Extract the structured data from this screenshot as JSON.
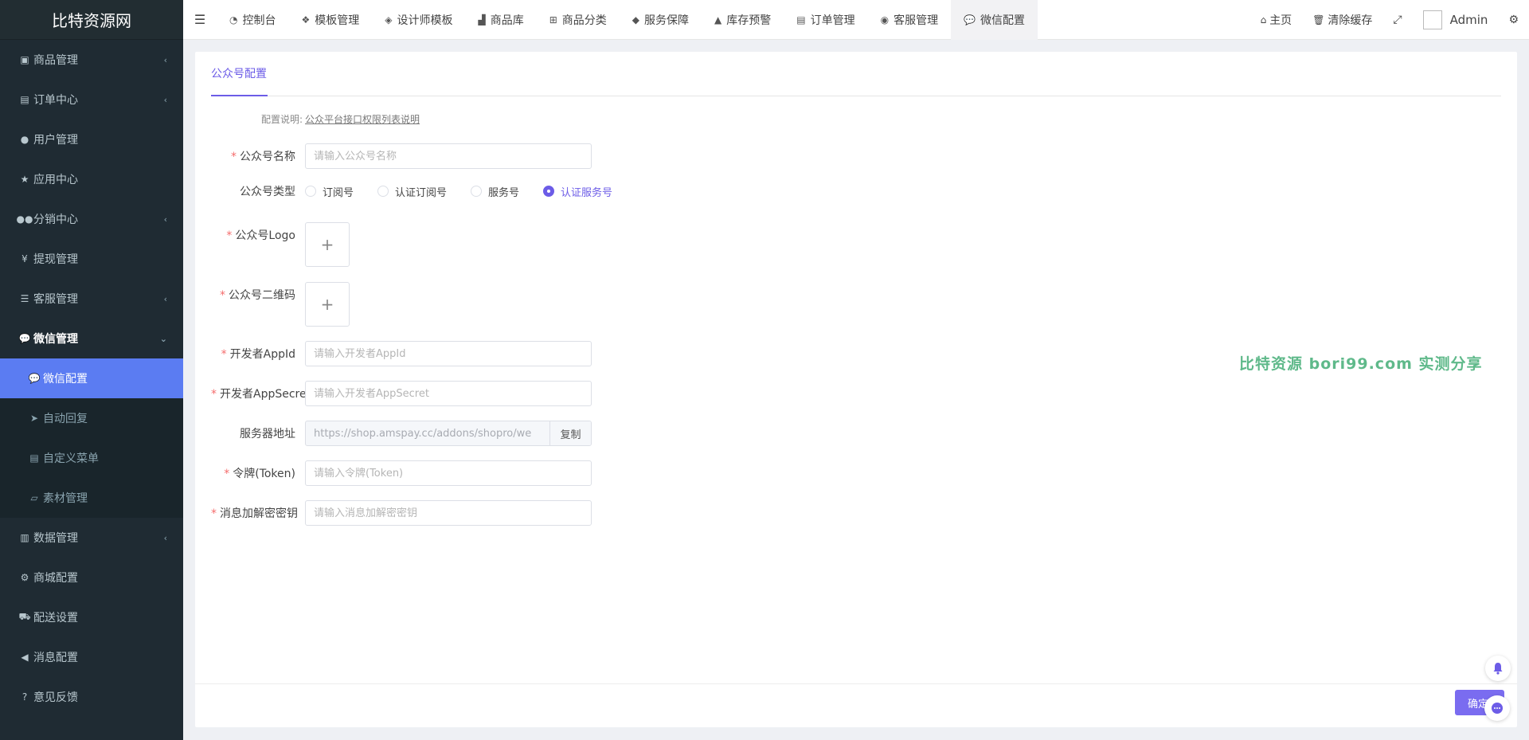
{
  "app": {
    "logo_text": "比特资源网"
  },
  "sidebar": {
    "items": [
      {
        "label": "商品管理",
        "icon": "archive-icon",
        "chevron": "‹"
      },
      {
        "label": "订单中心",
        "icon": "file-icon",
        "chevron": "‹"
      },
      {
        "label": "用户管理",
        "icon": "user-icon",
        "chevron": ""
      },
      {
        "label": "应用中心",
        "icon": "star-icon",
        "chevron": ""
      },
      {
        "label": "分销中心",
        "icon": "users-icon",
        "chevron": "‹"
      },
      {
        "label": "提现管理",
        "icon": "yen-icon",
        "chevron": ""
      },
      {
        "label": "客服管理",
        "icon": "list-icon",
        "chevron": "‹"
      },
      {
        "label": "微信管理",
        "icon": "wechat-icon",
        "chevron": "⌄"
      }
    ],
    "wechat_sub": [
      {
        "label": "微信配置",
        "icon": "comments-icon"
      },
      {
        "label": "自动回复",
        "icon": "paper-plane-icon"
      },
      {
        "label": "自定义菜单",
        "icon": "list-alt-icon"
      },
      {
        "label": "素材管理",
        "icon": "folder-open-icon"
      }
    ],
    "items_after": [
      {
        "label": "数据管理",
        "icon": "bar-chart-icon",
        "chevron": "‹"
      },
      {
        "label": "商城配置",
        "icon": "cogs-icon",
        "chevron": ""
      },
      {
        "label": "配送设置",
        "icon": "car-icon",
        "chevron": ""
      },
      {
        "label": "消息配置",
        "icon": "bullhorn-icon",
        "chevron": ""
      },
      {
        "label": "意见反馈",
        "icon": "question-icon",
        "chevron": ""
      }
    ]
  },
  "topbar": {
    "tabs": [
      {
        "label": "控制台",
        "icon": "dashboard-icon"
      },
      {
        "label": "模板管理",
        "icon": "cubes-icon"
      },
      {
        "label": "设计师模板",
        "icon": "cube-icon"
      },
      {
        "label": "商品库",
        "icon": "shopping-bag-icon"
      },
      {
        "label": "商品分类",
        "icon": "sitemap-icon"
      },
      {
        "label": "服务保障",
        "icon": "tags-icon"
      },
      {
        "label": "库存预警",
        "icon": "warning-icon"
      },
      {
        "label": "订单管理",
        "icon": "file-text-icon"
      },
      {
        "label": "客服管理",
        "icon": "user-circle-icon"
      },
      {
        "label": "微信配置",
        "icon": "comments-icon"
      }
    ],
    "home_label": "主页",
    "clear_cache_label": "清除缓存",
    "admin_name": "Admin"
  },
  "panel": {
    "tab_label": "公众号配置",
    "note_label": "配置说明:",
    "note_link": "公众平台接口权限列表说明",
    "fields": {
      "name_label": "公众号名称",
      "name_placeholder": "请输入公众号名称",
      "type_label": "公众号类型",
      "type_options": [
        "订阅号",
        "认证订阅号",
        "服务号",
        "认证服务号"
      ],
      "type_selected": "认证服务号",
      "logo_label": "公众号Logo",
      "qrcode_label": "公众号二维码",
      "appid_label": "开发者AppId",
      "appid_placeholder": "请输入开发者AppId",
      "appsecret_label": "开发者AppSecret",
      "appsecret_placeholder": "请输入开发者AppSecret",
      "server_label": "服务器地址",
      "server_value": "https://shop.amspay.cc/addons/shopro/we",
      "copy_label": "复制",
      "token_label": "令牌(Token)",
      "token_placeholder": "请输入令牌(Token)",
      "aeskey_label": "消息加解密密钥",
      "aeskey_placeholder": "请输入消息加解密密钥"
    },
    "confirm_label": "确定"
  },
  "watermark": "比特资源  bori99.com  实测分享",
  "colors": {
    "sidebar_bg": "#1f2b33",
    "active_item": "#5b7cf2",
    "accent": "#6c5ce7",
    "required": "#f56c6c",
    "watermark": "#5fb98a"
  }
}
